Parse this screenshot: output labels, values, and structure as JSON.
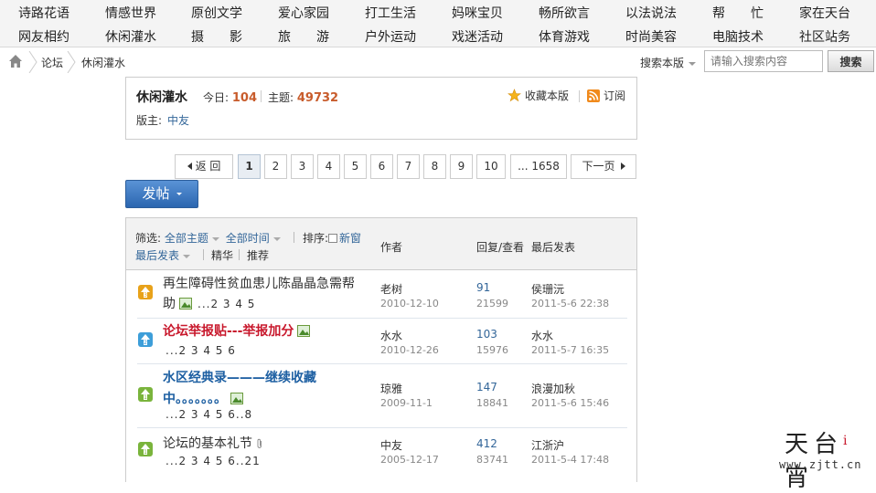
{
  "topnav": {
    "row1": [
      "诗路花语",
      "情感世界",
      "原创文学",
      "爱心家园",
      "打工生活",
      "妈咪宝贝",
      "畅所欲言",
      "以法说法",
      "帮　　忙",
      "家在天台"
    ],
    "row2": [
      "网友相约",
      "休闲灌水",
      "摄　　影",
      "旅　　游",
      "户外运动",
      "戏迷活动",
      "体育游戏",
      "时尚美容",
      "电脑技术",
      "社区站务"
    ]
  },
  "breadcrumb": {
    "items": [
      "论坛",
      "休闲灌水"
    ],
    "search_scope": "搜索本版",
    "search_placeholder": "请输入搜索内容",
    "search_button": "搜索"
  },
  "forum": {
    "name": "休闲灌水",
    "today_label": "今日:",
    "today_value": "104",
    "topics_label": "主题:",
    "topics_value": "49732",
    "favorite_label": "收藏本版",
    "subscribe_label": "订阅",
    "moderator_label": "版主:",
    "moderator": "中友"
  },
  "pager": {
    "prev": "返 回",
    "pages": [
      "1",
      "2",
      "3",
      "4",
      "5",
      "6",
      "7",
      "8",
      "9",
      "10"
    ],
    "current": "1",
    "last": "... 1658",
    "next": "下一页"
  },
  "post_button": "发帖",
  "list_header": {
    "filter_label": "筛选:",
    "all_topics": "全部主题",
    "all_time": "全部时间",
    "sort_label": "排序:",
    "new_window": "新窗",
    "last_post": "最后发表",
    "digest": "精华",
    "recommend": "推荐",
    "col_author": "作者",
    "col_replies": "回复/查看",
    "col_last": "最后发表"
  },
  "threads": [
    {
      "title_line1": "再生障碍性贫血患儿陈晶晶急需帮",
      "title_line2": "助",
      "pages": "...2 3 4 5",
      "author": "老树",
      "date": "2010-12-10",
      "replies": "91",
      "views": "21599",
      "last_by": "侯珊沅",
      "last_date": "2011-5-6 22:38",
      "icon_color": "#e8a21a"
    },
    {
      "title_line1": "论坛举报贴---举报加分",
      "pages": "...2 3 4 5 6",
      "author": "水水",
      "date": "2010-12-26",
      "replies": "103",
      "views": "15976",
      "last_by": "水水",
      "last_date": "2011-5-7 16:35",
      "icon_color": "#3d9ed9"
    },
    {
      "title_line1": "水区经典录———继续收藏",
      "title_line2": "中。。。。。。。",
      "pages": "...2 3 4 5 6..8",
      "author": "琼雅",
      "date": "2009-11-1",
      "replies": "147",
      "views": "18841",
      "last_by": "浪漫加秋",
      "last_date": "2011-5-6 15:46",
      "icon_color": "#7ab43c"
    },
    {
      "title_line1": "论坛的基本礼节",
      "pages": "...2 3 4 5 6..21",
      "author": "中友",
      "date": "2005-12-17",
      "replies": "412",
      "views": "83741",
      "last_by": "江浙沪",
      "last_date": "2011-5-4 17:48",
      "icon_color": "#7ab43c"
    }
  ],
  "watermark": {
    "logo": "天台",
    "logo_mark": "i",
    "logo_tail": "宵",
    "url": "www.zjtt.cn"
  }
}
